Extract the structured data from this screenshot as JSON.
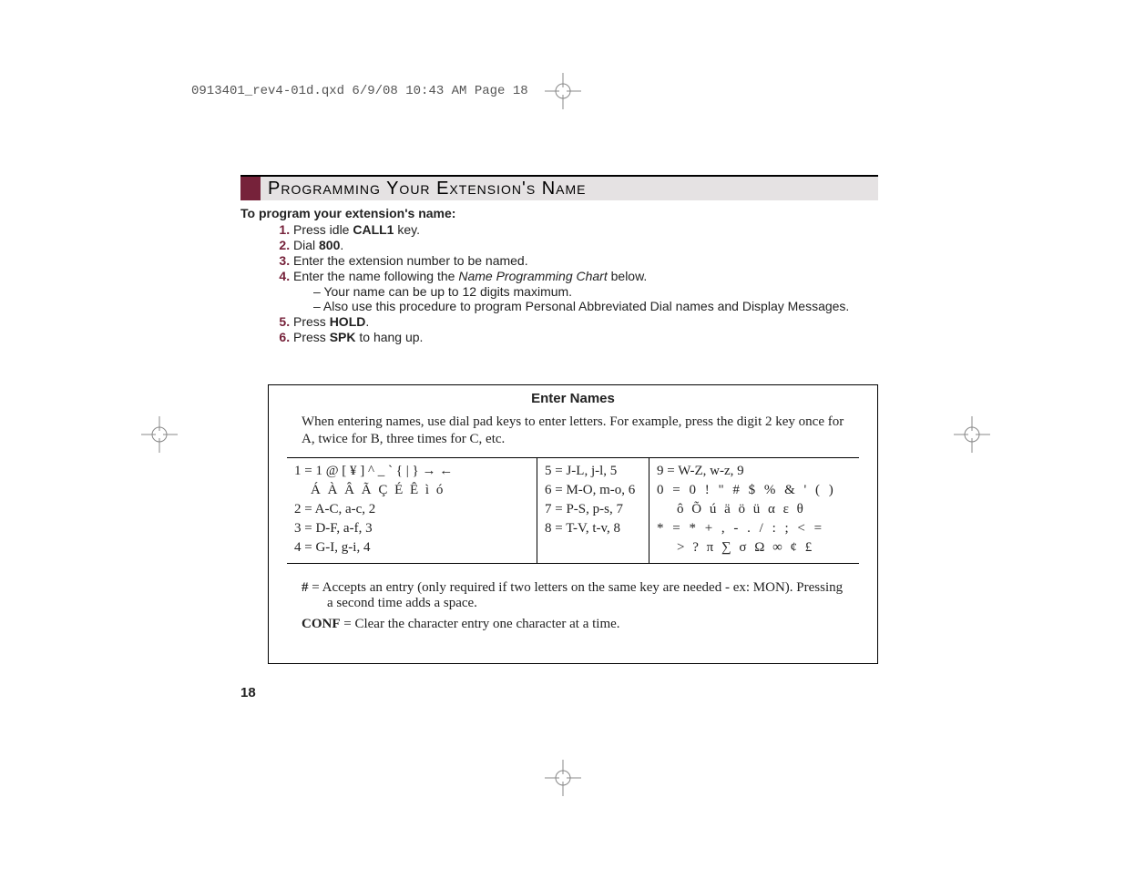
{
  "print_header": "0913401_rev4-01d.qxd  6/9/08  10:43 AM  Page 18",
  "title": "Programming Your Extension's Name",
  "intro": "To program your extension's name:",
  "steps": {
    "s1a": "Press idle ",
    "s1b": "CALL1",
    "s1c": " key.",
    "s2a": "Dial ",
    "s2b": "800",
    "s2c": ".",
    "s3": "Enter the extension number to be named.",
    "s4a": "Enter the name following the ",
    "s4b": "Name Programming Chart",
    "s4c": " below.",
    "s4_sub1": "Your name can be up to 12 digits maximum.",
    "s4_sub2": "Also use this procedure to program Personal Abbreviated Dial names and Display Messages.",
    "s5a": "Press ",
    "s5b": "HOLD",
    "s5c": ".",
    "s6a": "Press ",
    "s6b": "SPK",
    "s6c": " to hang up."
  },
  "chart": {
    "title": "Enter Names",
    "desc": "When entering names, use dial pad keys to enter letters. For example, press the digit 2 key once for A, twice for B, three times for C, etc.",
    "col1": {
      "r1": "1 = 1   @   [   ¥   ]   ^   _   `   {   |   }   →   ←",
      "r2": "Á  À  Â  Ã  Ç  É  Ê  ì  ó",
      "r3": "2 = A-C, a-c, 2",
      "r4": "3 = D-F, a-f, 3",
      "r5": "4 = G-I, g-i, 4"
    },
    "col2": {
      "r1": "5 = J-L, j-l, 5",
      "r2": "6 = M-O, m-o, 6",
      "r3": "7 = P-S, p-s, 7",
      "r4": "8 = T-V, t-v, 8"
    },
    "col3": {
      "r1": "9 = W-Z, w-z, 9",
      "r2": "0 = 0   !   \"   #   $   %   &   '   (   )",
      "r3": "ô  Õ  ú  ä  ö  ü  α  ε  θ",
      "r4": "* = *   +   ,   -   .   /   :   ;   <   =",
      "r5": ">   ?  π  ∑  σ  Ω  ∞  ¢  £"
    },
    "note1a": "#",
    "note1b": " = Accepts an entry (only required if two letters on the same key are needed - ex: MON). Pressing a second time adds a space.",
    "note2a": "CONF",
    "note2b": " = Clear the character entry one character at a time."
  },
  "page_number": "18"
}
